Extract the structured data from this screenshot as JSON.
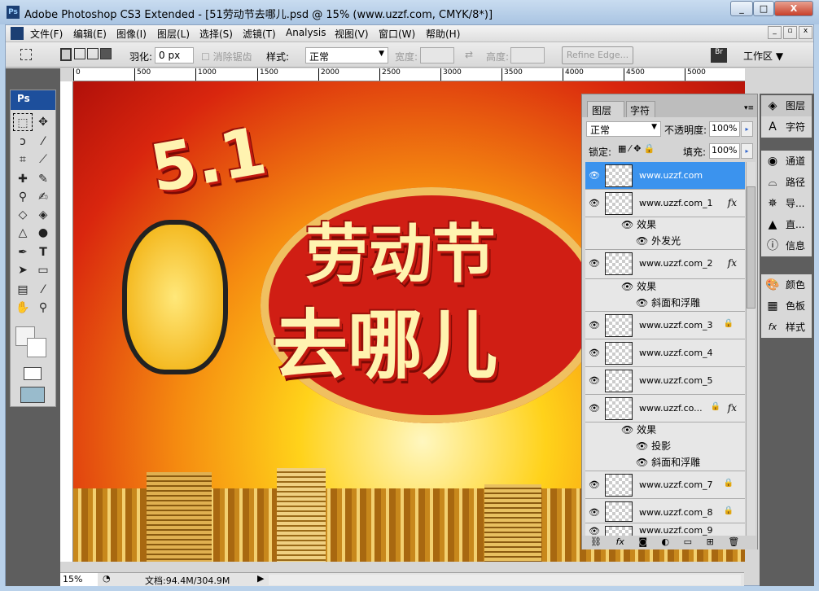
{
  "window": {
    "title": "Adobe Photoshop CS3 Extended - [51劳动节去哪儿.psd @ 15% (www.uzzf.com, CMYK/8*)]",
    "app_icon": "Ps"
  },
  "menu": [
    "文件(F)",
    "编辑(E)",
    "图像(I)",
    "图层(L)",
    "选择(S)",
    "滤镜(T)",
    "Analysis",
    "视图(V)",
    "窗口(W)",
    "帮助(H)"
  ],
  "options": {
    "feather_label": "羽化:",
    "feather_value": "0 px",
    "antialias_label": "消除锯齿",
    "style_label": "样式:",
    "style_value": "正常",
    "width_label": "宽度:",
    "height_label": "高度:",
    "refine_edge": "Refine Edge...",
    "workspace": "工作区 ▼"
  },
  "ruler": [
    "0",
    "500",
    "1000",
    "1500",
    "2000",
    "2500",
    "3000",
    "3500",
    "4000",
    "4500",
    "5000"
  ],
  "canvas": {
    "num": "5.1",
    "line1": "劳动节",
    "line2": "去哪儿"
  },
  "layers_panel": {
    "tabs": [
      "图层",
      "字符"
    ],
    "blend_mode": "正常",
    "opacity_label": "不透明度:",
    "opacity": "100%",
    "lock_label": "锁定:",
    "fill_label": "填充:",
    "fill": "100%",
    "layers": [
      {
        "name": "www.uzzf.com",
        "selected": true
      },
      {
        "name": "www.uzzf.com_1",
        "fx": "fx",
        "effects_label": "效果",
        "effects": [
          "外发光"
        ]
      },
      {
        "name": "www.uzzf.com_2",
        "fx": "fx",
        "effects_label": "效果",
        "effects": [
          "斜面和浮雕"
        ]
      },
      {
        "name": "www.uzzf.com_3",
        "locked": true
      },
      {
        "name": "www.uzzf.com_4"
      },
      {
        "name": "www.uzzf.com_5"
      },
      {
        "name": "www.uzzf.co...",
        "locked": true,
        "fx": "fx",
        "effects_label": "效果",
        "effects": [
          "投影",
          "斜面和浮雕"
        ]
      },
      {
        "name": "www.uzzf.com_7",
        "locked": true
      },
      {
        "name": "www.uzzf.com_8",
        "locked": true
      },
      {
        "name": "www.uzzf.com_9"
      }
    ],
    "footer_fx": "fx"
  },
  "dock": {
    "group1": [
      "图层",
      "字符"
    ],
    "group2": [
      "通道",
      "路径",
      "导...",
      "直...",
      "信息"
    ],
    "group3": [
      "颜色",
      "色板",
      "样式"
    ]
  },
  "status": {
    "zoom": "15%",
    "doc": "文档:94.4M/304.9M"
  }
}
